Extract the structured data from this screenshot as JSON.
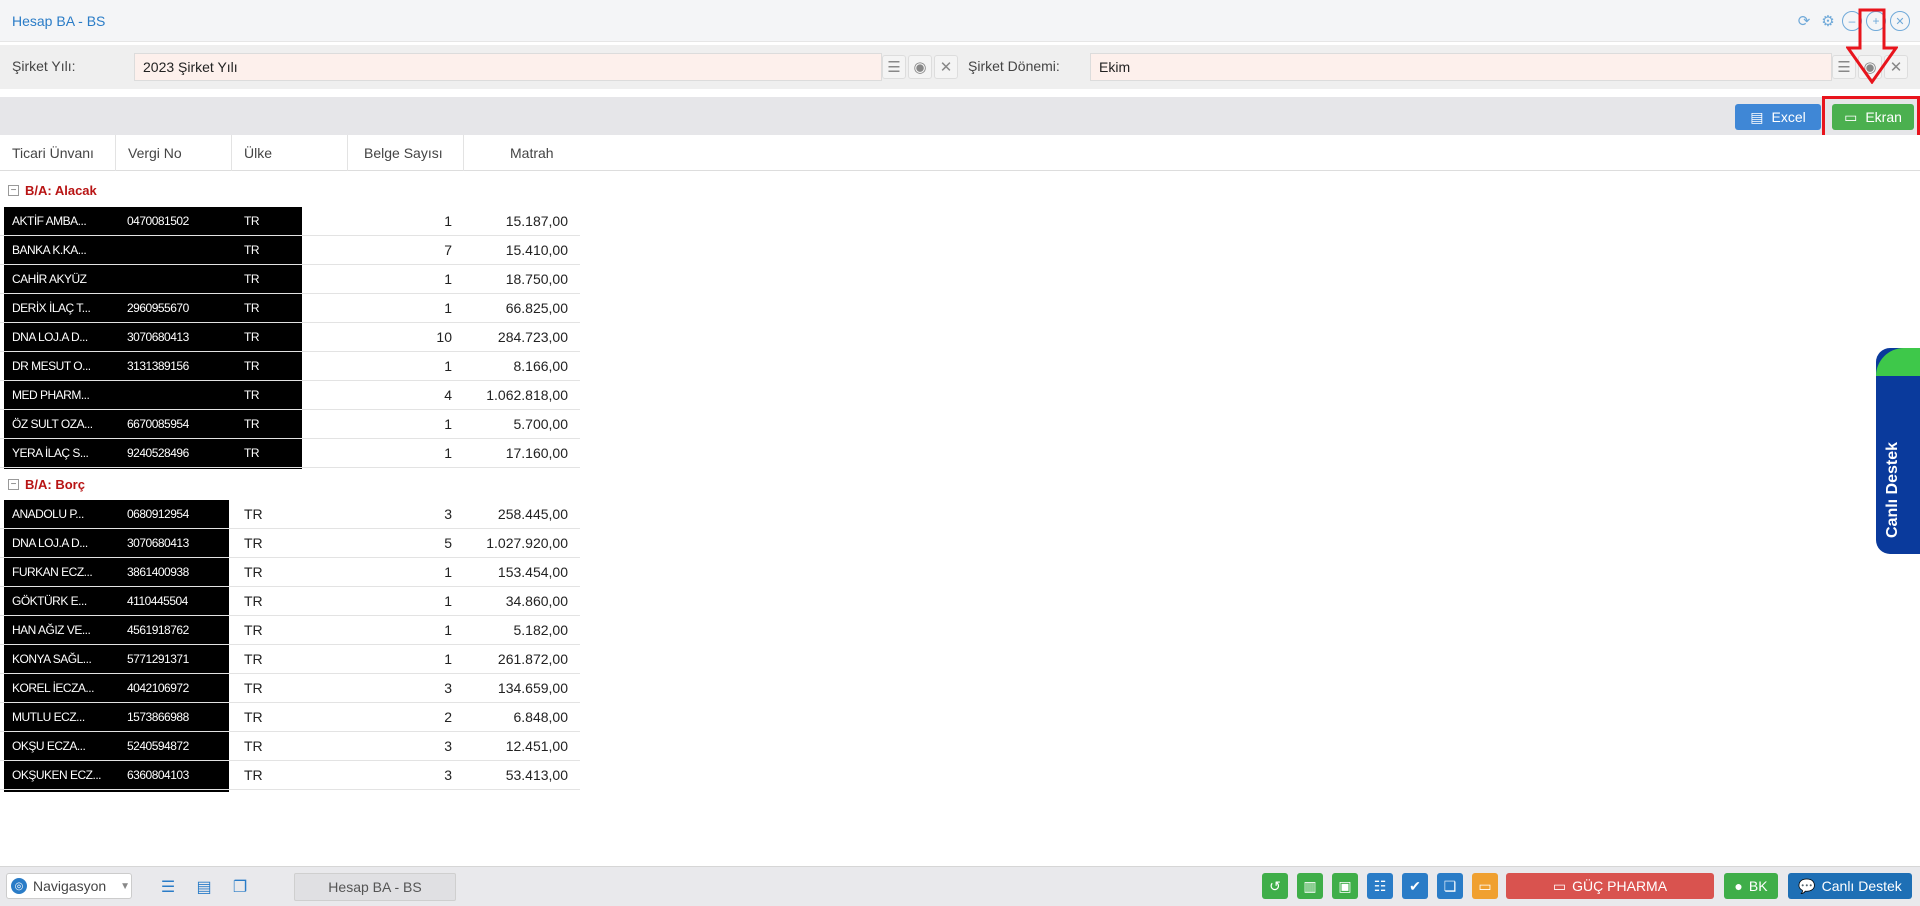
{
  "window": {
    "title": "Hesap BA - BS",
    "title_icons": [
      "refresh-icon",
      "gear-icon",
      "minimize-icon",
      "maximize-icon",
      "close-icon"
    ]
  },
  "filters": {
    "company_year_label": "Şirket Yılı:",
    "company_year_value": "2023 Şirket Yılı",
    "company_period_label": "Şirket Dönemi:",
    "company_period_value": "Ekim"
  },
  "actions": {
    "excel_label": "Excel",
    "ekran_label": "Ekran"
  },
  "columns": [
    "Ticari Ünvanı",
    "Vergi No",
    "Ülke",
    "Belge Sayısı",
    "Matrah"
  ],
  "groups": [
    {
      "label": "B/A: Alacak",
      "rows": [
        {
          "unvan": "AKTİF AMBA...",
          "vergi": "0470081502",
          "ulke": "TR",
          "belge": "1",
          "matrah": "15.187,00"
        },
        {
          "unvan": "BANKA K.KA...",
          "vergi": "",
          "ulke": "TR",
          "belge": "7",
          "matrah": "15.410,00"
        },
        {
          "unvan": "CAHİR AKYÜZ",
          "vergi": "",
          "ulke": "TR",
          "belge": "1",
          "matrah": "18.750,00"
        },
        {
          "unvan": "DERİX İLAÇ T...",
          "vergi": "2960955670",
          "ulke": "TR",
          "belge": "1",
          "matrah": "66.825,00"
        },
        {
          "unvan": "DNA LOJ.A D...",
          "vergi": "3070680413",
          "ulke": "TR",
          "belge": "10",
          "matrah": "284.723,00"
        },
        {
          "unvan": "DR MESUT O...",
          "vergi": "3131389156",
          "ulke": "TR",
          "belge": "1",
          "matrah": "8.166,00"
        },
        {
          "unvan": "MED PHARM...",
          "vergi": "",
          "ulke": "TR",
          "belge": "4",
          "matrah": "1.062.818,00"
        },
        {
          "unvan": "ÖZ SULT OZA...",
          "vergi": "6670085954",
          "ulke": "TR",
          "belge": "1",
          "matrah": "5.700,00"
        },
        {
          "unvan": "YERA İLAÇ S...",
          "vergi": "9240528496",
          "ulke": "TR",
          "belge": "1",
          "matrah": "17.160,00"
        }
      ]
    },
    {
      "label": "B/A: Borç",
      "rows": [
        {
          "unvan": "ANADOLU P...",
          "vergi": "0680912954",
          "ulke": "TR",
          "belge": "3",
          "matrah": "258.445,00"
        },
        {
          "unvan": "DNA LOJ.A D...",
          "vergi": "3070680413",
          "ulke": "TR",
          "belge": "5",
          "matrah": "1.027.920,00"
        },
        {
          "unvan": "FURKAN ECZ...",
          "vergi": "3861400938",
          "ulke": "TR",
          "belge": "1",
          "matrah": "153.454,00"
        },
        {
          "unvan": "GÖKTÜRK E...",
          "vergi": "4110445504",
          "ulke": "TR",
          "belge": "1",
          "matrah": "34.860,00"
        },
        {
          "unvan": "HAN AĞIZ VE...",
          "vergi": "4561918762",
          "ulke": "TR",
          "belge": "1",
          "matrah": "5.182,00"
        },
        {
          "unvan": "KONYA SAĞL...",
          "vergi": "5771291371",
          "ulke": "TR",
          "belge": "1",
          "matrah": "261.872,00"
        },
        {
          "unvan": "KOREL İECZA...",
          "vergi": "4042106972",
          "ulke": "TR",
          "belge": "3",
          "matrah": "134.659,00"
        },
        {
          "unvan": "MUTLU ECZ...",
          "vergi": "1573866988",
          "ulke": "TR",
          "belge": "2",
          "matrah": "6.848,00"
        },
        {
          "unvan": "OKŞU ECZA...",
          "vergi": "5240594872",
          "ulke": "TR",
          "belge": "3",
          "matrah": "12.451,00"
        },
        {
          "unvan": "OKŞUKEN ECZ...",
          "vergi": "6360804103",
          "ulke": "TR",
          "belge": "3",
          "matrah": "53.413,00"
        }
      ]
    }
  ],
  "side_tab": {
    "label": "Canlı Destek"
  },
  "taskbar": {
    "nav_label": "Navigasyon",
    "task_label": "Hesap BA - BS",
    "company_label": "GÜÇ PHARMA",
    "user_label": "BK",
    "support_label": "Canlı Destek",
    "colors": {
      "green": "#3fae49",
      "blue": "#2a7cc7",
      "orange": "#f0a030",
      "red": "#d9534f",
      "navy": "#1e6fb5"
    }
  }
}
